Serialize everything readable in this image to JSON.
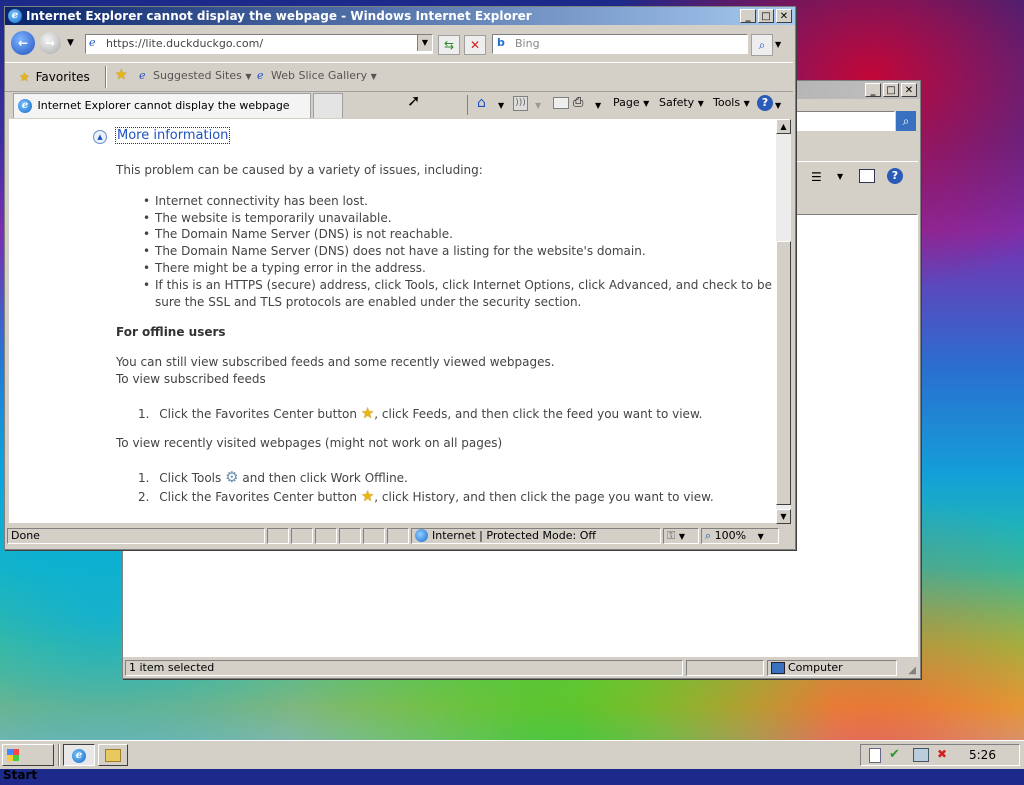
{
  "ie": {
    "title": "Internet Explorer cannot display the webpage - Windows Internet Explorer",
    "address": "https://lite.duckduckgo.com/",
    "search_placeholder": "Bing",
    "favorites_label": "Favorites",
    "suggested_sites": "Suggested Sites",
    "web_slice_gallery": "Web Slice Gallery",
    "tab_title": "Internet Explorer cannot display the webpage",
    "cmd": {
      "page": "Page",
      "safety": "Safety",
      "tools": "Tools"
    },
    "status": {
      "left": "Done",
      "zone": "Internet | Protected Mode: Off",
      "zoom": "100%"
    }
  },
  "page": {
    "more_info": "More information",
    "intro": "This problem can be caused by a variety of issues, including:",
    "issues": [
      "Internet connectivity has been lost.",
      "The website is temporarily unavailable.",
      "The Domain Name Server (DNS) is not reachable.",
      "The Domain Name Server (DNS) does not have a listing for the website's domain.",
      "There might be a typing error in the address.",
      "If this is an HTTPS (secure) address, click Tools, click Internet Options, click Advanced, and check to be",
      "sure the SSL and TLS protocols are enabled under the security section."
    ],
    "offline_heading": "For offline users",
    "offline_intro_1": "You can still view subscribed feeds and some recently viewed webpages.",
    "offline_intro_2": "To view subscribed feeds",
    "feeds_step": {
      "num": "1.",
      "a": "Click the Favorites Center button",
      "b": ", click Feeds, and then click the feed you want to view."
    },
    "recent_heading": "To view recently visited webpages (might not work on all pages)",
    "recent_steps": [
      {
        "num": "1.",
        "a": "Click Tools",
        "b": "and then click Work Offline."
      },
      {
        "num": "2.",
        "a": "Click the Favorites Center button",
        "b": ", click History, and then click the page you want to view."
      }
    ]
  },
  "explorer": {
    "status_left": "1 item selected",
    "status_right": "Computer"
  },
  "taskbar": {
    "start": "Start",
    "clock": "5:26"
  }
}
